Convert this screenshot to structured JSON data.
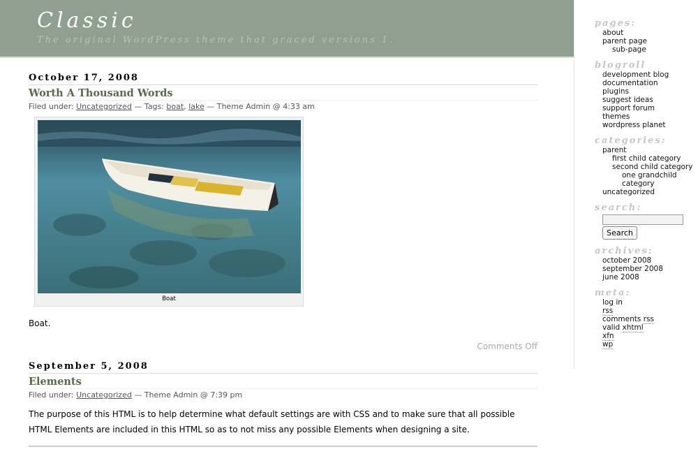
{
  "header": {
    "title": "Classic",
    "description": "The original WordPress theme that graced versions 1."
  },
  "posts": [
    {
      "date": "October 17, 2008",
      "title": "Worth A Thousand Words",
      "meta": {
        "filed_under": "Filed under:",
        "category": "Uncategorized",
        "tags_prefix": "— Tags:",
        "tag1": "boat",
        "tag_sep": ",",
        "tag2": "lake",
        "byline": "— Theme Admin @ 4:33 am"
      },
      "caption": "Boat",
      "body": "Boat.",
      "comments": "Comments Off"
    },
    {
      "date": "September 5, 2008",
      "title": "Elements",
      "meta": {
        "filed_under": "Filed under:",
        "category": "Uncategorized",
        "byline": "— Theme Admin @ 7:39 pm"
      },
      "body": "The purpose of this HTML is to help determine what default settings are with CSS and to make sure that all possible HTML Elements are included in this HTML so as to not miss any possible Elements when designing a site."
    }
  ],
  "sidebar": {
    "pages_heading": "pages:",
    "pages": [
      "about",
      "parent page",
      "sub-page"
    ],
    "blogroll_heading": "blogroll",
    "blogroll": [
      "development blog",
      "documentation",
      "plugins",
      "suggest ideas",
      "support forum",
      "themes",
      "wordpress planet"
    ],
    "categories_heading": "categories:",
    "categories": [
      "parent",
      "first child category",
      "second child category",
      "one grandchild",
      "category",
      "uncategorized"
    ],
    "search_heading": "search:",
    "search_value": "",
    "search_button": "Search",
    "archives_heading": "archives:",
    "archives": [
      "october 2008",
      "september 2008",
      "june 2008"
    ],
    "meta_heading": "meta:",
    "meta": {
      "login": "log in",
      "rss": "rss",
      "comments": "comments",
      "comments_rss": "rss",
      "valid": "valid",
      "xhtml": "xhtml",
      "xfn": "xfn",
      "wp": "wp"
    }
  },
  "colors": {
    "header_bg": "#90a090",
    "title_green": "#5a6a48"
  }
}
